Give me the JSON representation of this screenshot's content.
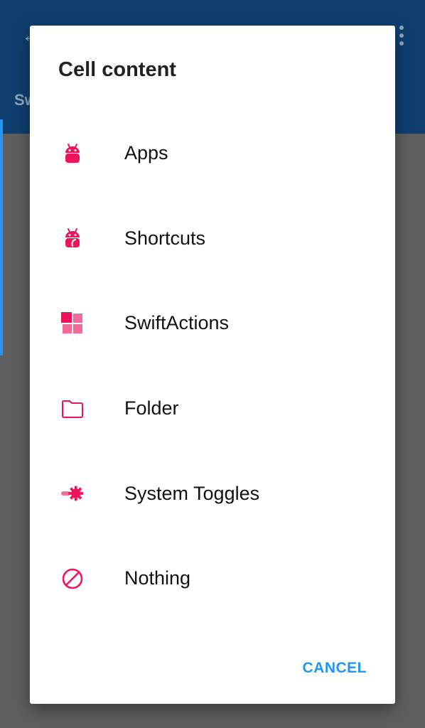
{
  "background": {
    "tab_text": "Sw",
    "appbar_color": "#0f3f6f"
  },
  "dialog": {
    "title": "Cell content",
    "options": [
      {
        "label": "Apps",
        "icon": "android-icon"
      },
      {
        "label": "Shortcuts",
        "icon": "shortcut-android-icon"
      },
      {
        "label": "SwiftActions",
        "icon": "swiftactions-icon"
      },
      {
        "label": "Folder",
        "icon": "folder-icon"
      },
      {
        "label": "System Toggles",
        "icon": "toggle-gear-icon"
      },
      {
        "label": "Nothing",
        "icon": "block-icon"
      }
    ],
    "cancel_label": "CANCEL"
  },
  "colors": {
    "accent": "#ed145b",
    "accent_light": "#f36b95",
    "button": "#2196f3",
    "scrim": "#5f5f5f"
  }
}
